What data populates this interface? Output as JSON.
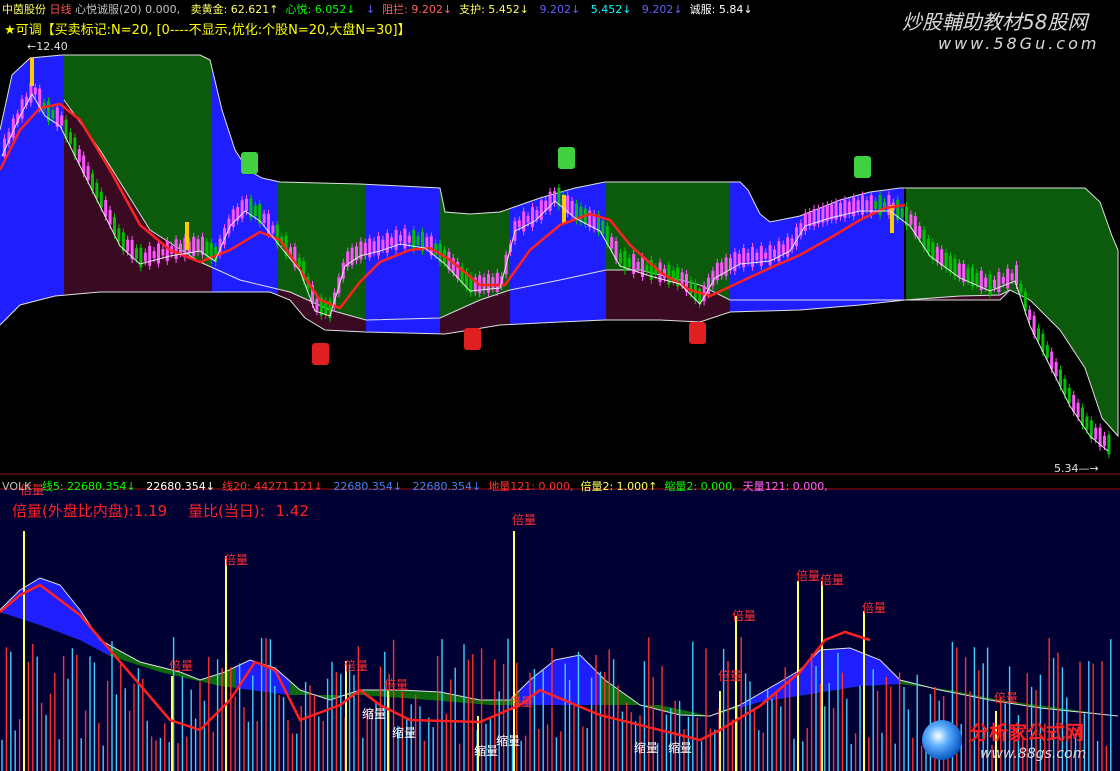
{
  "top_header": {
    "stock_name": "中茵股份",
    "period": "日线",
    "indicator_name": "心悦诚服(20)",
    "first_value": "0.000,",
    "items": [
      {
        "label": "卖黄金:",
        "value": "62.621",
        "arrow": "↑"
      },
      {
        "label": "心悦:",
        "value": "6.052",
        "arrow": "↓"
      },
      {
        "label": "",
        "value": "",
        "arrow": "↓"
      },
      {
        "label": "阻拦:",
        "value": "9.202",
        "arrow": "↓"
      },
      {
        "label": "支护:",
        "value": "5.452",
        "arrow": "↓"
      },
      {
        "label": "",
        "value": "9.202",
        "arrow": "↓"
      },
      {
        "label": "",
        "value": "5.452",
        "arrow": "↓"
      },
      {
        "label": "",
        "value": "9.202",
        "arrow": "↓"
      },
      {
        "label": "诚服:",
        "value": "5.84",
        "arrow": "↓"
      }
    ]
  },
  "second_header": {
    "prefix": "可调",
    "text": "【买卖标记:N=20, [0----不显示,优化:个股N=20,大盘N=30]】"
  },
  "price_labels": {
    "high": "12.40",
    "low": "5.34"
  },
  "volume_header": {
    "name": "VOLK",
    "items": [
      {
        "label": "线5:",
        "value": "22680.354",
        "arrow": "↓"
      },
      {
        "label": "",
        "value": "22680.354",
        "arrow": "↓"
      },
      {
        "label": "线20:",
        "value": "44271.121",
        "arrow": "↓"
      },
      {
        "label": "",
        "value": "22680.354",
        "arrow": "↓"
      },
      {
        "label": "",
        "value": "22680.354",
        "arrow": "↓"
      },
      {
        "label": "地量121:",
        "value": "0.000,",
        "arrow": ""
      },
      {
        "label": "倍量2:",
        "value": "1.000",
        "arrow": "↑"
      },
      {
        "label": "缩量2:",
        "value": "0.000,",
        "arrow": ""
      },
      {
        "label": "天量121:",
        "value": "0.000,",
        "arrow": ""
      }
    ]
  },
  "volume_ratio": {
    "ratio_label": "倍量(外盘比内盘):",
    "ratio_value": "1.19",
    "liangbi_label": "量比(当日):",
    "liangbi_value": "1.42"
  },
  "annotations": {
    "double_volume": "倍量",
    "shrink_volume": "缩量"
  },
  "watermarks": {
    "top_title": "炒股輔助教材58股网",
    "top_url": "www.58Gu.com",
    "bottom_title": "分析家公式网",
    "bottom_url": "www.88gs.com"
  },
  "colors": {
    "up_candle": "#ff55ff",
    "down_candle": "#00c000",
    "band_blue": "#1e1eff",
    "band_green": "#0c5a0c",
    "band_maroon": "#3a0a22",
    "ma_red": "#ff2020",
    "volume_bg": "#000033",
    "header_text": "#c0c0c0",
    "accent_yellow": "#ffff00"
  }
}
